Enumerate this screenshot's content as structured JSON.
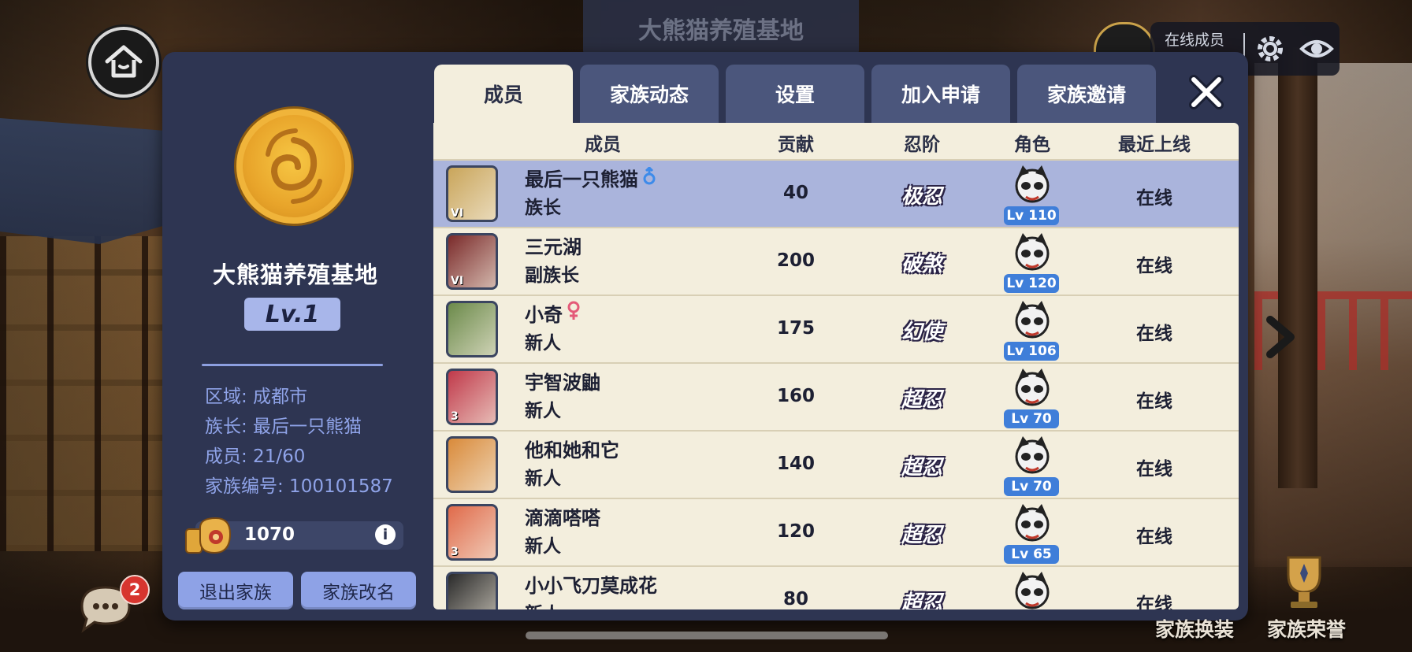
{
  "header": {
    "banner_title": "大熊猫养殖基地",
    "online_label": "在线成员"
  },
  "family": {
    "name": "大熊猫养殖基地",
    "level": "Lv.1",
    "region": "区域: 成都市",
    "leader": "族长: 最后一只熊猫",
    "members": "成员: 21/60",
    "family_id": "家族编号: 100101587",
    "funds": "1070",
    "info_symbol": "i",
    "quit_button": "退出家族",
    "rename_button": "家族改名"
  },
  "tabs": [
    {
      "label": "成员",
      "active": true
    },
    {
      "label": "家族动态",
      "active": false
    },
    {
      "label": "设置",
      "active": false
    },
    {
      "label": "加入申请",
      "active": false
    },
    {
      "label": "家族邀请",
      "active": false
    }
  ],
  "table": {
    "headers": [
      "成员",
      "贡献",
      "忍阶",
      "角色",
      "最近上线"
    ],
    "rows": [
      {
        "name": "最后一只熊猫",
        "gender": "male",
        "role": "族长",
        "contribution": "40",
        "rank": "极忍",
        "level": "Lv 110",
        "last_online": "在线",
        "highlight": true,
        "icon_color": "#c9a55a",
        "tier": "VI"
      },
      {
        "name": "三元湖",
        "gender": "",
        "role": "副族长",
        "contribution": "200",
        "rank": "破煞",
        "level": "Lv 120",
        "last_online": "在线",
        "highlight": false,
        "icon_color": "#7a2a2a",
        "tier": "VI"
      },
      {
        "name": "小奇",
        "gender": "female",
        "role": "新人",
        "contribution": "175",
        "rank": "幻使",
        "level": "Lv 106",
        "last_online": "在线",
        "highlight": false,
        "icon_color": "#6b8a4a",
        "tier": ""
      },
      {
        "name": "宇智波鼬",
        "gender": "",
        "role": "新人",
        "contribution": "160",
        "rank": "超忍",
        "level": "Lv 70",
        "last_online": "在线",
        "highlight": false,
        "icon_color": "#c0394a",
        "tier": "3"
      },
      {
        "name": "他和她和它",
        "gender": "",
        "role": "新人",
        "contribution": "140",
        "rank": "超忍",
        "level": "Lv 70",
        "last_online": "在线",
        "highlight": false,
        "icon_color": "#d98a3a",
        "tier": ""
      },
      {
        "name": "滴滴嗒嗒",
        "gender": "",
        "role": "新人",
        "contribution": "120",
        "rank": "超忍",
        "level": "Lv 65",
        "last_online": "在线",
        "highlight": false,
        "icon_color": "#e06a4a",
        "tier": "3"
      },
      {
        "name": "小小飞刀莫成花",
        "gender": "",
        "role": "新人",
        "contribution": "80",
        "rank": "超忍",
        "level": "",
        "last_online": "在线",
        "highlight": false,
        "icon_color": "#2a2a2a",
        "tier": ""
      }
    ]
  },
  "chat": {
    "badge_count": "2"
  },
  "bottom": {
    "left_label": "家族换装",
    "right_label": "家族荣誉"
  },
  "colors": {
    "panel": "#2e3552",
    "tab_active": "#f3eedd",
    "highlight_row": "#aab4dc",
    "level_tag": "#3f7ed9",
    "accent_text": "#8fa3e8"
  },
  "icons": {
    "home": "home-icon",
    "settings": "gear-icon",
    "visibility": "eye-icon",
    "close": "close-icon",
    "funds": "coin-bag-icon",
    "info": "info-icon",
    "chat": "chat-bubble-icon",
    "male": "male-symbol-icon",
    "female": "female-symbol-icon",
    "next": "chevron-right-icon",
    "honor": "trophy-icon"
  }
}
